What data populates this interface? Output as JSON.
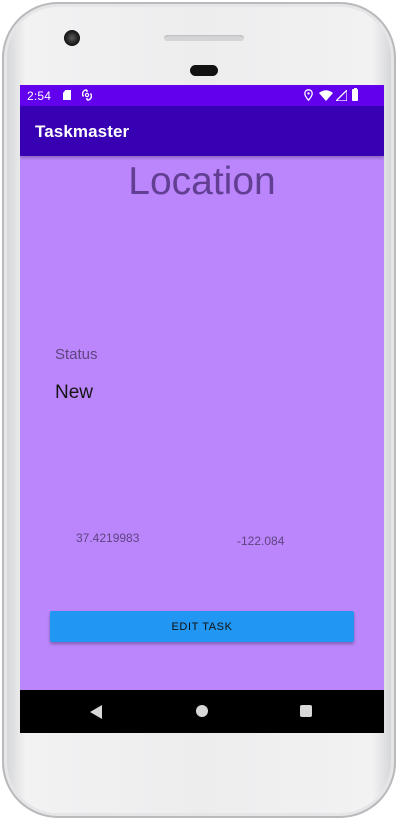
{
  "status_bar": {
    "time": "2:54",
    "icons": [
      "sd-card-icon",
      "sync-icon",
      "location-icon",
      "wifi-icon",
      "cellular-signal-icon",
      "battery-icon"
    ]
  },
  "app_bar": {
    "title": "Taskmaster"
  },
  "main": {
    "heading": "Location",
    "status_label": "Status",
    "status_value": "New",
    "latitude": "37.4219983",
    "longitude": "-122.084",
    "edit_button_label": "EDIT TASK"
  },
  "navigation_bar": {
    "icons": [
      "back-icon",
      "home-icon",
      "recents-icon"
    ]
  },
  "colors": {
    "status_bar": "#6200ee",
    "app_bar": "#3700b3",
    "background": "#bb86fc",
    "button": "#2196f3",
    "navigation_bar": "#000000"
  }
}
